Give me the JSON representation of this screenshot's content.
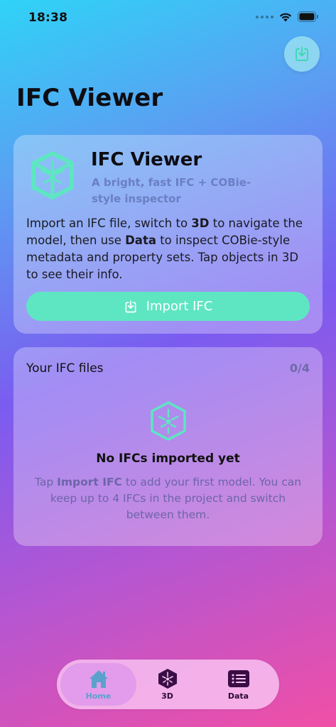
{
  "status_bar": {
    "time": "18:38"
  },
  "header": {
    "title": "IFC Viewer"
  },
  "hero": {
    "title": "IFC Viewer",
    "subtitle": "A bright, fast IFC + COBie-style inspector",
    "body_parts": [
      "Import an IFC file, switch to ",
      "3D",
      " to navigate the model, then use ",
      "Data",
      " to inspect COBie-style metadata and property sets. Tap objects in 3D to see their info."
    ],
    "import_label": "Import IFC"
  },
  "files": {
    "title": "Your IFC files",
    "count": "0/4",
    "empty_title": "No IFCs imported yet",
    "empty_body_parts": [
      "Tap ",
      "Import IFC",
      " to add your first model. You can keep up to 4 IFCs in the project and switch between them."
    ]
  },
  "tabs": [
    {
      "label": "Home",
      "icon": "house-icon",
      "selected": true
    },
    {
      "label": "3D",
      "icon": "cube-icon",
      "selected": false
    },
    {
      "label": "Data",
      "icon": "list-icon",
      "selected": false
    }
  ],
  "colors": {
    "accent": "#5EE6C2",
    "tab_selected": "#5AA2CC",
    "subtitle": "#6A7FC4"
  }
}
